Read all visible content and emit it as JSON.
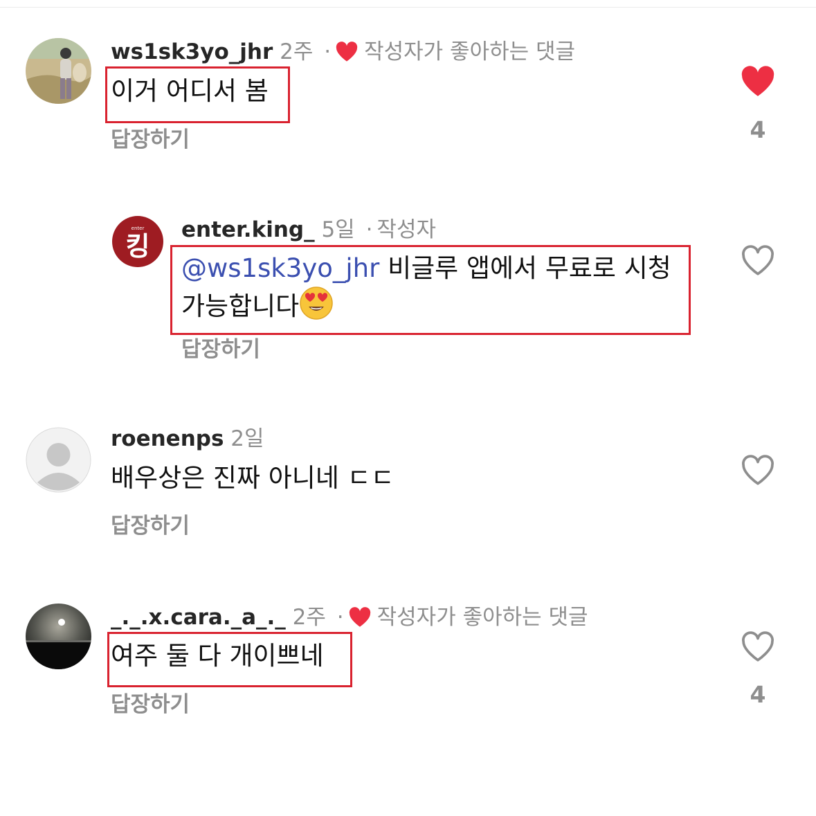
{
  "colors": {
    "like_red": "#ED2F43",
    "annotation_red": "#D9222F",
    "mention_blue": "#3B4FB0",
    "secondary_text": "#8E8E8E"
  },
  "comments": [
    {
      "username": "ws1sk3yo_jhr",
      "time": "2주",
      "separator": "·",
      "creator_liked_label": "작성자가 좋아하는 댓글",
      "text": "이거 어디서 봄",
      "reply_label": "답장하기",
      "liked": true,
      "like_count": "4"
    },
    {
      "username": "enter.king_",
      "time": "5일",
      "separator": "·",
      "author_badge": "작성자",
      "avatar_text": "킹",
      "avatar_small_text": "enter",
      "mention": "@ws1sk3yo_jhr",
      "text": " 비글루 앱에서  무료로 시청 가능합니다",
      "reply_label": "답장하기",
      "liked": false
    },
    {
      "username": "roenenps",
      "time": "2일",
      "text": "배우상은 진짜 아니네 ㄷㄷ",
      "reply_label": "답장하기",
      "liked": false
    },
    {
      "username": "_._.x.cara._a_._",
      "time": "2주",
      "separator": "·",
      "creator_liked_label": "작성자가 좋아하는 댓글",
      "text": "여주 둘 다 개이쁘네",
      "reply_label": "답장하기",
      "liked": false,
      "like_count": "4"
    }
  ]
}
